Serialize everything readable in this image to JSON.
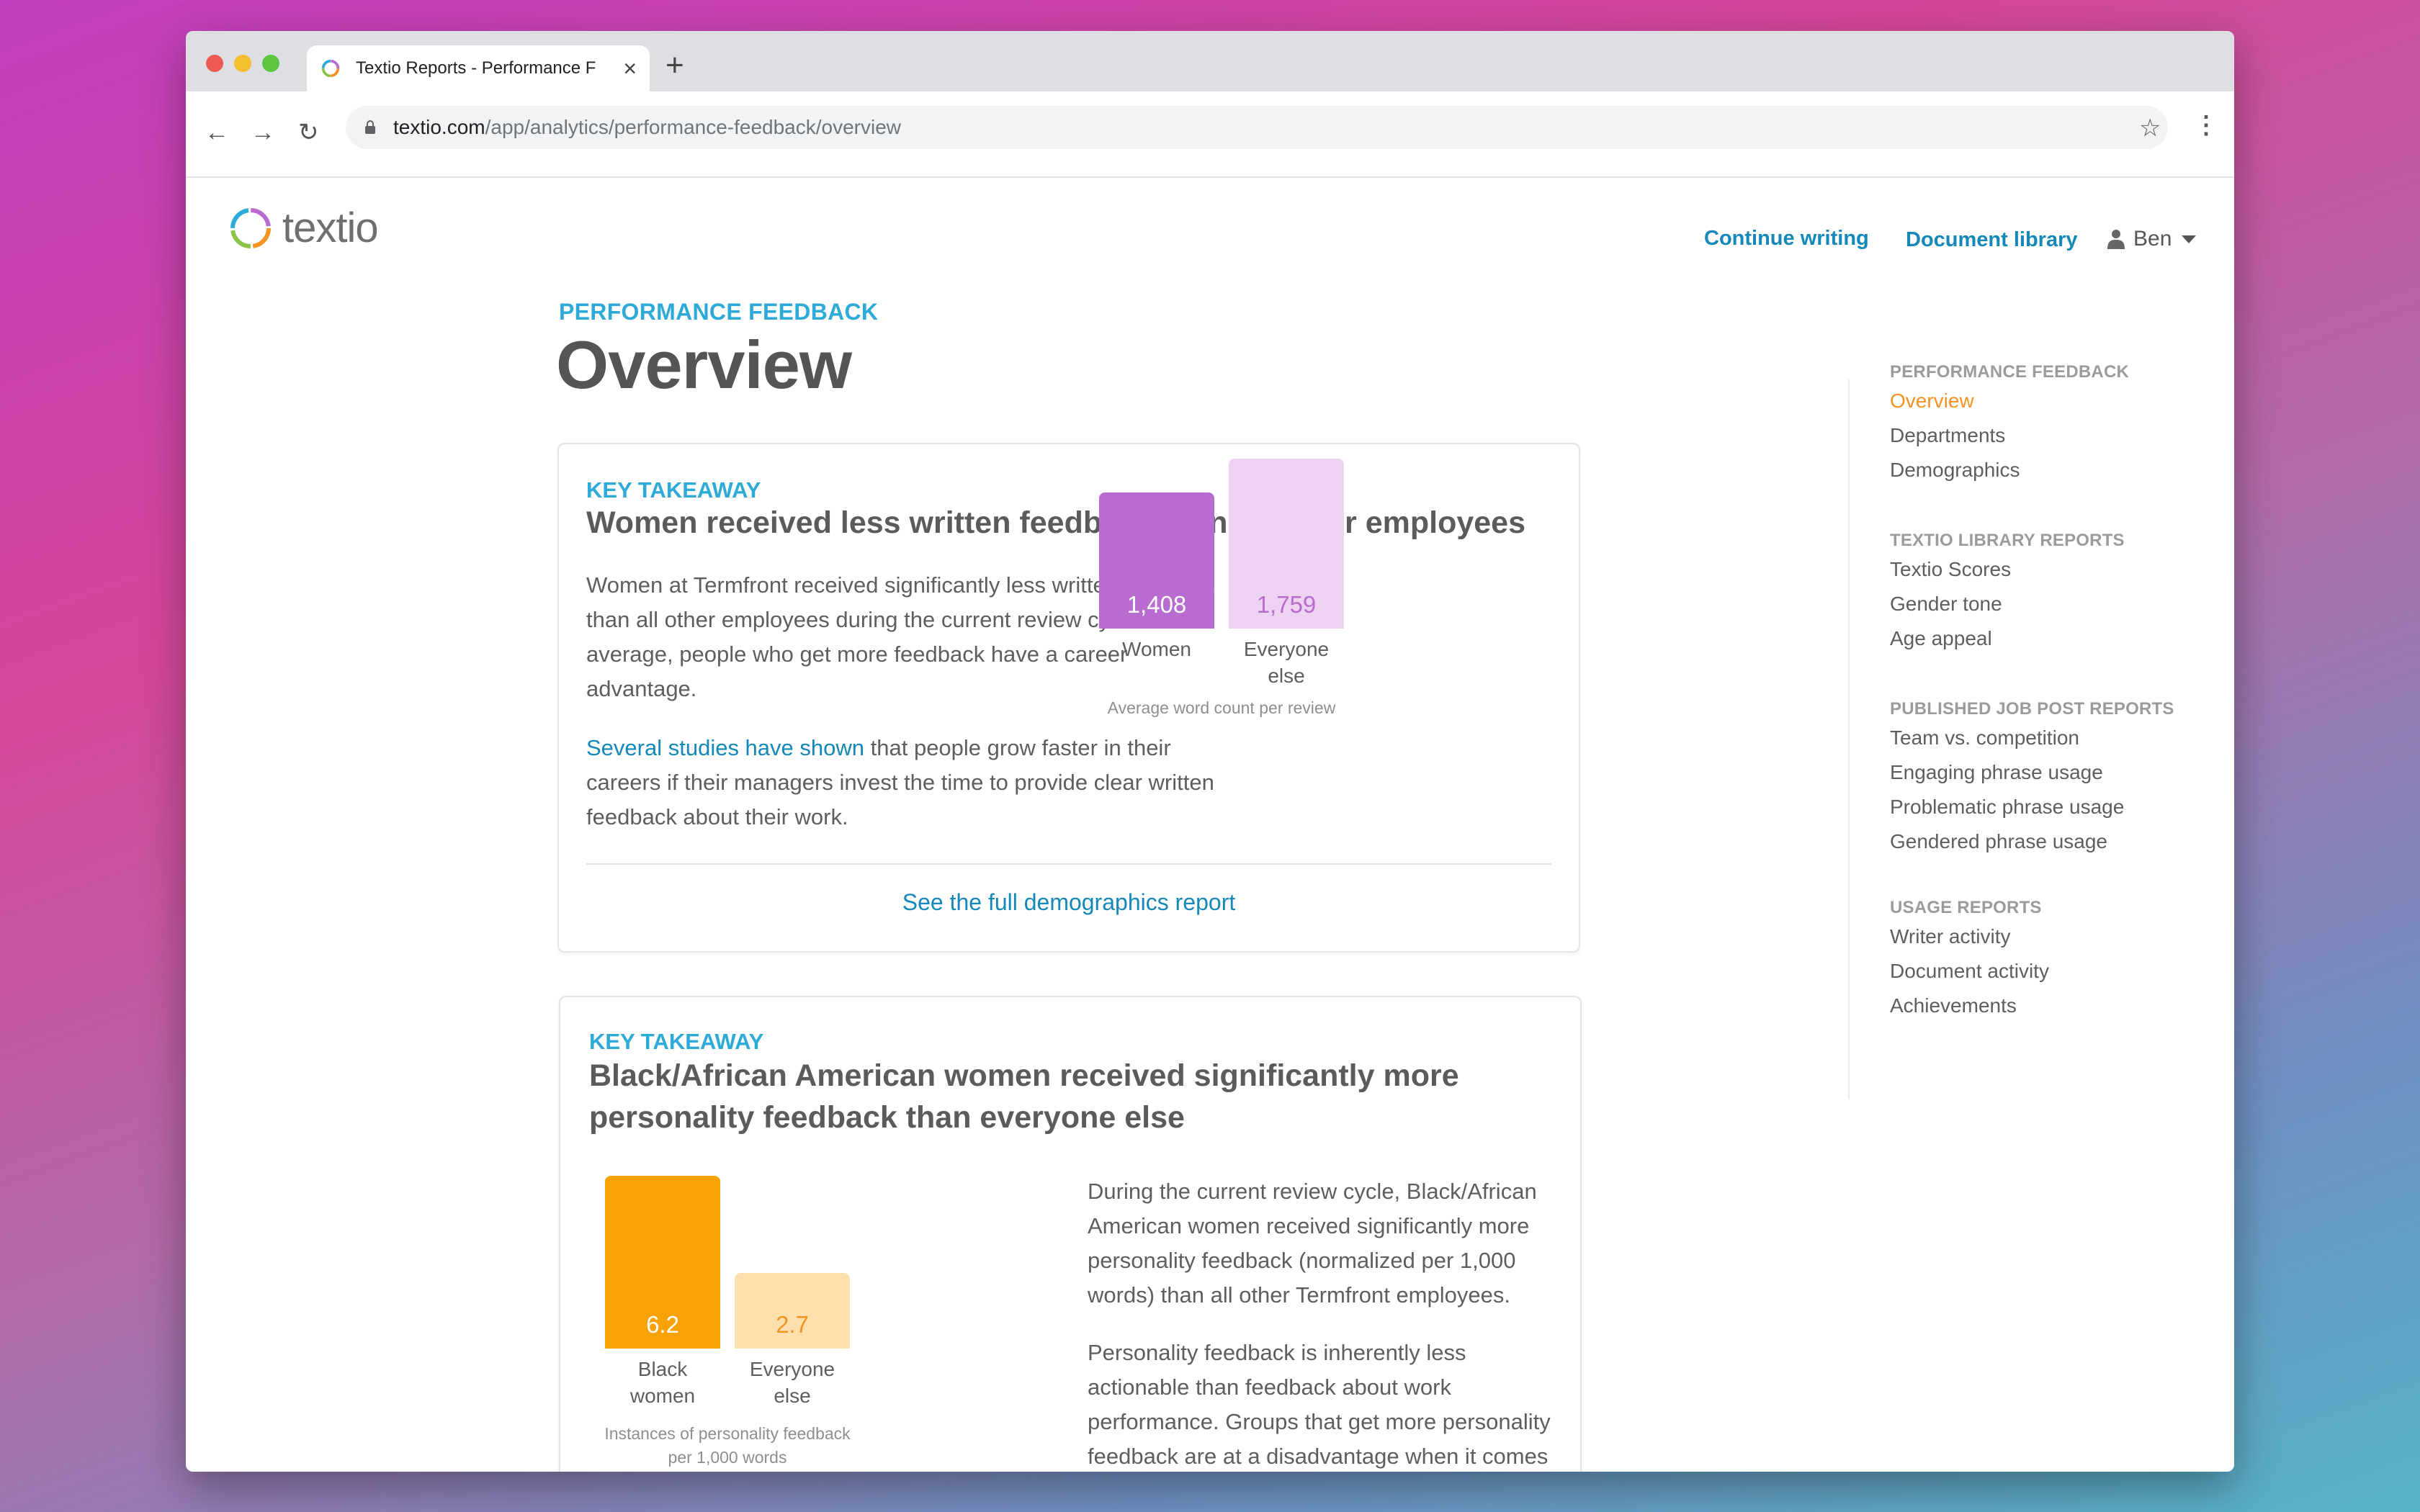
{
  "browser": {
    "tab_title": "Textio Reports - Performance F",
    "url_host": "textio.com",
    "url_path": "/app/analytics/performance-feedback/overview"
  },
  "header": {
    "logo_text": "textio",
    "continue_writing": "Continue writing",
    "document_library": "Document library",
    "user_name": "Ben"
  },
  "page": {
    "eyebrow": "PERFORMANCE FEEDBACK",
    "title": "Overview"
  },
  "card1": {
    "eyebrow": "KEY TAKEAWAY",
    "heading": "Women received less written feedback than all other employees",
    "para1": "Women at Termfront received significantly less written feedback than all other employees during the current review cycle. On average, people who get more feedback have a career advantage.",
    "para2_link": "Several studies have shown",
    "para2_rest": " that people grow faster in their careers if their managers invest the time to provide clear written feedback about their work.",
    "footer_link": "See the full demographics report"
  },
  "card2": {
    "eyebrow": "KEY TAKEAWAY",
    "heading_line1": "Black/African American women received significantly more",
    "heading_line2": "personality feedback than everyone else",
    "para1": "During the current review cycle, Black/African American women received significantly more personality feedback (normalized per 1,000 words) than all other Termfront employees.",
    "para2": "Personality feedback is inherently less actionable than feedback about work performance. Groups that get more personality feedback are at a disadvantage when it comes to demonstrating growth and achieving career advancement."
  },
  "chart_data": [
    {
      "type": "bar",
      "categories": [
        "Women",
        "Everyone else"
      ],
      "category_lines": [
        [
          "Women"
        ],
        [
          "Everyone",
          "else"
        ]
      ],
      "values": [
        1408,
        1759
      ],
      "value_labels": [
        "1,408",
        "1,759"
      ],
      "colors": [
        "#b86ccf",
        "#edd3f1"
      ],
      "value_colors": [
        "#ffffff",
        "#b86ccf"
      ],
      "caption": "Average word count per review",
      "ylim": [
        0,
        1759
      ]
    },
    {
      "type": "bar",
      "categories": [
        "Black women",
        "Everyone else"
      ],
      "category_lines": [
        [
          "Black",
          "women"
        ],
        [
          "Everyone",
          "else"
        ]
      ],
      "values": [
        6.2,
        2.7
      ],
      "value_labels": [
        "6.2",
        "2.7"
      ],
      "colors": [
        "#f9a206",
        "#fde0ae"
      ],
      "value_colors": [
        "#ffffff",
        "#f39323"
      ],
      "caption_lines": [
        "Instances of personality feedback",
        "per 1,000 words"
      ],
      "ylim": [
        0,
        6.2
      ]
    }
  ],
  "sidenav": {
    "sections": [
      {
        "title": "PERFORMANCE FEEDBACK",
        "items": [
          "Overview",
          "Departments",
          "Demographics"
        ]
      },
      {
        "title": "TEXTIO LIBRARY REPORTS",
        "items": [
          "Textio Scores",
          "Gender tone",
          "Age appeal"
        ]
      },
      {
        "title": "PUBLISHED JOB POST REPORTS",
        "items": [
          "Team vs. competition",
          "Engaging phrase usage",
          "Problematic phrase usage",
          "Gendered phrase usage"
        ]
      },
      {
        "title": "USAGE REPORTS",
        "items": [
          "Writer activity",
          "Document activity",
          "Achievements"
        ]
      }
    ],
    "active_item": "Overview"
  },
  "colors": {
    "accent_blue": "#2eaad9",
    "link_blue": "#1488b8",
    "active_orange": "#f39323"
  }
}
